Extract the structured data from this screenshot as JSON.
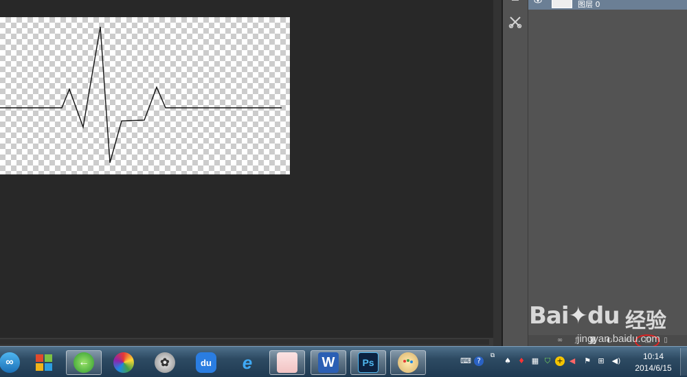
{
  "layers": {
    "layer_name": "图层 0",
    "eye_icon": "eye-icon"
  },
  "tool_strip": {
    "icons": [
      "collapse-icon",
      "tools-icon"
    ]
  },
  "panel_footer": {
    "icons": [
      "link-icon",
      "fx-icon",
      "mask-icon",
      "adjustment-icon",
      "folder-icon",
      "new-layer-icon",
      "trash-icon"
    ]
  },
  "watermark": {
    "logo": "Bai",
    "logo_suffix": "du",
    "brand_cn": "经验",
    "url": "jingyan.baidu.com"
  },
  "taskbar": {
    "apps": [
      "start",
      "windows-store",
      "green-browser",
      "multicolor-app",
      "media-player",
      "baidu-du",
      "internet-explorer",
      "image-viewer",
      "word",
      "photoshop",
      "paint"
    ],
    "active_apps": [
      "green-browser",
      "word",
      "photoshop",
      "paint"
    ],
    "word_label": "W",
    "ps_label": "Ps",
    "du_label": "du",
    "ie_label": "e"
  },
  "clock": {
    "time": "10:14",
    "date": "2014/6/15"
  },
  "colors": {
    "canvas_bg": "#282828",
    "panel_bg": "#535353",
    "selected_layer": "#6b7f95",
    "highlight": "#dd2222"
  }
}
